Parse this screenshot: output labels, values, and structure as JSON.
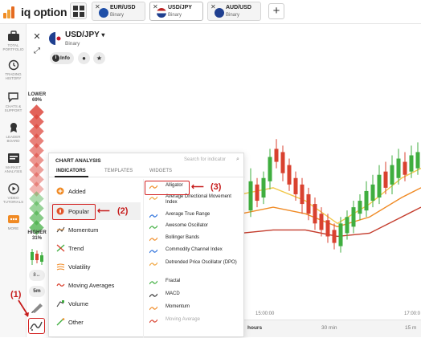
{
  "app": {
    "logo_text": "iq option"
  },
  "tabs": [
    {
      "name": "EUR/USD",
      "type": "Binary",
      "active": false
    },
    {
      "name": "USD/JPY",
      "type": "Binary",
      "active": true
    },
    {
      "name": "AUD/USD",
      "type": "Binary",
      "active": false
    }
  ],
  "sidebar": {
    "items": [
      {
        "label": "TOTAL\nPORTFOLIO",
        "icon": "briefcase-icon"
      },
      {
        "label": "TRADING\nHISTORY",
        "icon": "history-icon"
      },
      {
        "label": "CHATS &\nSUPPORT",
        "icon": "chat-icon"
      },
      {
        "label": "LEADER\nBOARD",
        "icon": "leaderboard-icon"
      },
      {
        "label": "MARKET\nANALYSIS",
        "icon": "market-analysis-icon"
      },
      {
        "label": "VIDEO\nTUTORIALS",
        "icon": "video-icon"
      },
      {
        "label": "MORE",
        "icon": "more-icon"
      }
    ]
  },
  "asset": {
    "pair": "USD/JPY",
    "pair_caret": "▾",
    "type": "Binary",
    "info_label": "Info"
  },
  "sentiment": {
    "lower_label": "LOWER",
    "lower_pct": "69%",
    "higher_label": "HIGHER",
    "higher_pct": "31%",
    "lower_fraction": 0.69,
    "higher_fraction": 0.31
  },
  "chart_toolbar": {
    "timeframe": "5m"
  },
  "time_axis": {
    "ticks": [
      "15:00:00",
      "17:00:0"
    ],
    "ranges": [
      "hours",
      "30 min",
      "15 m"
    ]
  },
  "panel": {
    "title": "CHART ANALYSIS",
    "search_placeholder": "Search for indicator",
    "tabs": [
      "INDICATORS",
      "TEMPLATES",
      "WIDGETS"
    ],
    "categories": [
      {
        "label": "Added",
        "icon": "plus-circle-icon"
      },
      {
        "label": "Popular",
        "icon": "fire-icon"
      },
      {
        "label": "Momentum",
        "icon": "momentum-icon"
      },
      {
        "label": "Trend",
        "icon": "trend-icon"
      },
      {
        "label": "Volatility",
        "icon": "volatility-icon"
      },
      {
        "label": "Moving Averages",
        "icon": "moving-average-icon"
      },
      {
        "label": "Volume",
        "icon": "volume-icon"
      },
      {
        "label": "Other",
        "icon": "other-icon"
      }
    ],
    "indicators": [
      "Alligator",
      "Average Directional Movement Index",
      "Average True Range",
      "Awesome Oscillator",
      "Bollinger Bands",
      "Commodity Channel Index",
      "Detrended Price Oscillator (DPO)",
      "Fractal",
      "MACD",
      "Momentum",
      "Moving Average"
    ]
  },
  "annotations": {
    "step1": "(1)",
    "step2": "(2)",
    "step3": "(3)",
    "arrow": "⟵"
  },
  "colors": {
    "accent_orange": "#f08a24",
    "up_green": "#3fae3f",
    "down_red": "#d9412f",
    "annotation_red": "#d32020"
  }
}
